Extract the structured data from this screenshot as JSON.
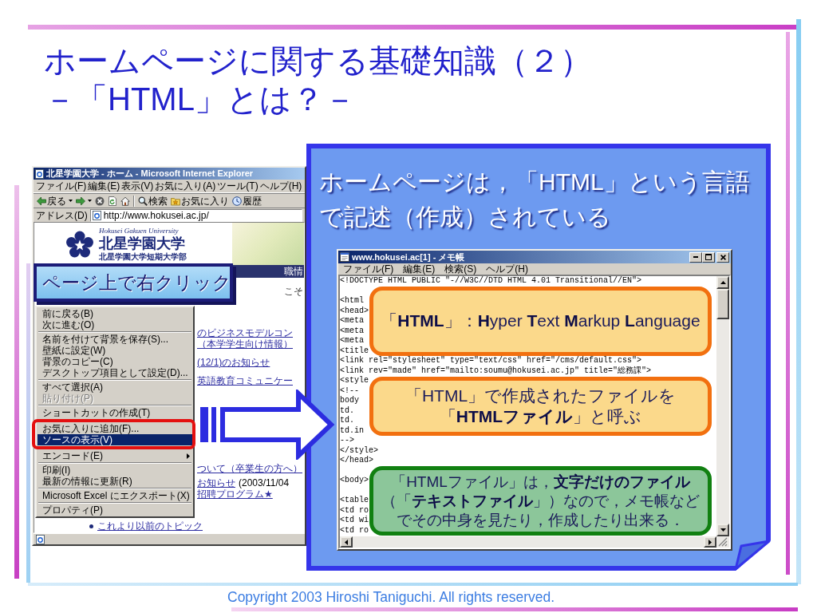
{
  "slide": {
    "title": "ホームページに関する基礎知識（２）",
    "subtitle": "－「HTML」とは？－",
    "copyright": "Copyright 2003 Hiroshi Taniguchi. All rights reserved."
  },
  "browser": {
    "title": "北星学園大学 - ホーム - Microsoft Internet Explorer",
    "menu": [
      "ファイル(F)",
      "編集(E)",
      "表示(V)",
      "お気に入り(A)",
      "ツール(T)",
      "ヘルプ(H)"
    ],
    "toolbar": [
      {
        "kind": "back",
        "label": "戻る"
      },
      {
        "kind": "forward"
      },
      {
        "kind": "stop"
      },
      {
        "kind": "refresh"
      },
      {
        "kind": "home"
      },
      {
        "kind": "search",
        "label": "検索"
      },
      {
        "kind": "favorites",
        "label": "お気に入り"
      },
      {
        "kind": "history",
        "label": "履歴"
      }
    ],
    "address": {
      "label": "アドレス(D)",
      "value": "http://www.hokusei.ac.jp/"
    },
    "page": {
      "tagline": "Hokusei Gakuen University",
      "name": "北星学園大学",
      "subname": "北星学園大学短期大学部",
      "nav_fragment": "職情",
      "welcome_fragment": "こそ",
      "topics": [
        {
          "parts": [
            {
              "kind": "link",
              "text": "のビジネスモデルコン"
            }
          ]
        },
        {
          "parts": [
            {
              "kind": "link",
              "text": "（本学学生向け情報）"
            }
          ]
        },
        {
          "parts": [
            {
              "kind": "link",
              "text": "(12/1)のお知らせ"
            }
          ]
        },
        {
          "parts": [
            {
              "kind": "link",
              "text": "英語教育コミュニケー"
            }
          ]
        },
        {
          "parts": [
            {
              "kind": "link",
              "text": "ついて（卒業生の方へ）"
            }
          ]
        },
        {
          "parts": [
            {
              "kind": "link",
              "text": "お知らせ"
            },
            {
              "kind": "plain",
              "text": "(2003/11/04"
            }
          ]
        },
        {
          "parts": [
            {
              "kind": "link",
              "text": "招聘プログラム★"
            }
          ]
        }
      ],
      "more_link": "これより以前のトピック"
    },
    "context_menu": {
      "groups": [
        [
          {
            "label": "前に戻る(B)",
            "selected": false,
            "disabled": false,
            "submenu": false,
            "framed": false
          },
          {
            "label": "次に進む(O)",
            "selected": false,
            "disabled": false,
            "submenu": false,
            "framed": false
          }
        ],
        [
          {
            "label": "名前を付けて背景を保存(S)...",
            "selected": false,
            "disabled": false,
            "submenu": false,
            "framed": false
          },
          {
            "label": "壁紙に設定(W)",
            "selected": false,
            "disabled": false,
            "submenu": false,
            "framed": false
          },
          {
            "label": "背景のコピー(C)",
            "selected": false,
            "disabled": false,
            "submenu": false,
            "framed": false
          },
          {
            "label": "デスクトップ項目として設定(D)...",
            "selected": false,
            "disabled": false,
            "submenu": false,
            "framed": false
          }
        ],
        [
          {
            "label": "すべて選択(A)",
            "selected": false,
            "disabled": false,
            "submenu": false,
            "framed": false
          },
          {
            "label": "貼り付け(P)",
            "selected": false,
            "disabled": true,
            "submenu": false,
            "framed": false
          }
        ],
        [
          {
            "label": "ショートカットの作成(T)",
            "selected": false,
            "disabled": false,
            "submenu": false,
            "framed": false
          },
          {
            "label": "お気に入りに追加(F)...",
            "selected": false,
            "disabled": false,
            "submenu": false,
            "framed": true
          },
          {
            "label": "ソースの表示(V)",
            "selected": true,
            "disabled": false,
            "submenu": false,
            "framed": true
          },
          {
            "label": "エンコード(E)",
            "selected": false,
            "disabled": false,
            "submenu": true,
            "framed": false
          }
        ],
        [
          {
            "label": "印刷(I)",
            "selected": false,
            "disabled": false,
            "submenu": false,
            "framed": false
          },
          {
            "label": "最新の情報に更新(R)",
            "selected": false,
            "disabled": false,
            "submenu": false,
            "framed": false
          }
        ],
        [
          {
            "label": "Microsoft Excel にエクスポート(X)",
            "selected": false,
            "disabled": false,
            "submenu": false,
            "framed": false
          }
        ],
        [
          {
            "label": "プロパティ(P)",
            "selected": false,
            "disabled": false,
            "submenu": false,
            "framed": false
          }
        ]
      ]
    }
  },
  "instruction_label": "ページ上で右クリック",
  "panel": {
    "heading": "ホームページは，「HTML」という言語で記述（作成）されている"
  },
  "notepad": {
    "title": "www.hokusei.ac[1] - メモ帳",
    "menu": [
      "ファイル(F)",
      "編集(E)",
      "検索(S)",
      "ヘルプ(H)"
    ],
    "code_blocks": [
      [
        "<!DOCTYPE HTML PUBLIC \"-//W3C//DTD HTML 4.01 Transitional//EN\">"
      ],
      [
        "<html",
        "<head>",
        "<meta",
        "<meta",
        "<meta",
        "<title",
        "<link rel=\"stylesheet\" type=\"text/css\" href=\"/cms/default.css\">",
        "<link rev=\"made\" href=\"mailto:soumu@hokusei.ac.jp\" title=\"総務課\">",
        "<style",
        "<!--",
        "body",
        "td.",
        "td.",
        "td.in",
        "-->",
        "</style>",
        "</head>"
      ],
      [
        "<body>"
      ],
      [
        "<table",
        "<td ro",
        "<td wi",
        "<td ro"
      ]
    ],
    "callouts": [
      {
        "kind": "definition",
        "text": "「**HTML**」：**H**yper **T**ext **M**arkup **L**anguage"
      },
      {
        "kind": "definition",
        "text": "「HTML」で作成されたファイルを「**HTMLファイル**」と呼ぶ"
      },
      {
        "kind": "note",
        "text": "「HTMLファイル」は，**文字だけのファイル**（「**テキストファイル**」）なので，メモ帳などでその中身を見たり，作成したり出来る．"
      }
    ]
  }
}
